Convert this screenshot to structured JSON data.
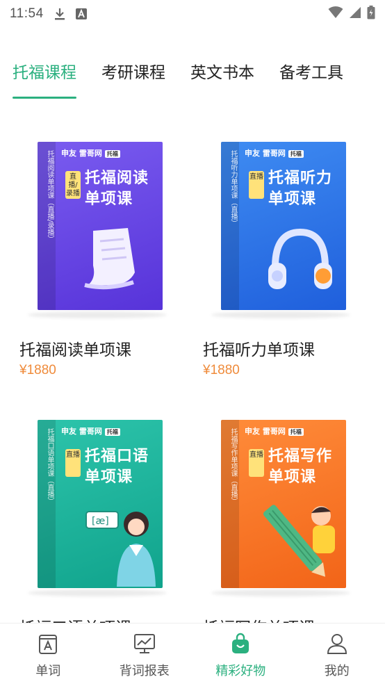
{
  "status_bar": {
    "time": "11:54",
    "icons": [
      "download-icon",
      "a-box-icon",
      "wifi-icon",
      "signal-icon",
      "battery-icon"
    ]
  },
  "tabs": [
    {
      "label": "托福课程",
      "active": true
    },
    {
      "label": "考研课程",
      "active": false
    },
    {
      "label": "英文书本",
      "active": false
    },
    {
      "label": "备考工具",
      "active": false
    }
  ],
  "products": [
    {
      "name": "托福阅读单项课",
      "price": "¥1880",
      "cover": {
        "brand": "申友",
        "brand_sub": "雷哥网",
        "tag": "托福",
        "badge": "直播/录播",
        "title_line1": "托福阅读",
        "title_line2": "单项课",
        "spine": "托福阅读单项课（直播/录播）",
        "color": "#6a47e6"
      }
    },
    {
      "name": "托福听力单项课",
      "price": "¥1880",
      "cover": {
        "brand": "申友",
        "brand_sub": "雷哥网",
        "tag": "托福",
        "badge": "直播",
        "title_line1": "托福听力",
        "title_line2": "单项课",
        "spine": "托福听力单项课（直播）",
        "color": "#2f78ea"
      }
    },
    {
      "name": "托福口语单项课",
      "price": "",
      "cover": {
        "brand": "申友",
        "brand_sub": "雷哥网",
        "tag": "托福",
        "badge": "直播",
        "title_line1": "托福口语",
        "title_line2": "单项课",
        "spine": "托福口语单项课（直播）",
        "color": "#1fb49c"
      }
    },
    {
      "name": "托福写作单项课",
      "price": "",
      "cover": {
        "brand": "申友",
        "brand_sub": "雷哥网",
        "tag": "托福",
        "badge": "直播",
        "title_line1": "托福写作",
        "title_line2": "单项课",
        "spine": "托福写作单项课（直播）",
        "color": "#f97828"
      }
    }
  ],
  "bottom_nav": [
    {
      "label": "单词",
      "icon": "word-book-icon",
      "active": false
    },
    {
      "label": "背词报表",
      "icon": "report-chart-icon",
      "active": false
    },
    {
      "label": "精彩好物",
      "icon": "shopping-bag-icon",
      "active": true
    },
    {
      "label": "我的",
      "icon": "person-icon",
      "active": false
    }
  ],
  "colors": {
    "accent": "#2bb07f",
    "price": "#ef8b3b"
  }
}
